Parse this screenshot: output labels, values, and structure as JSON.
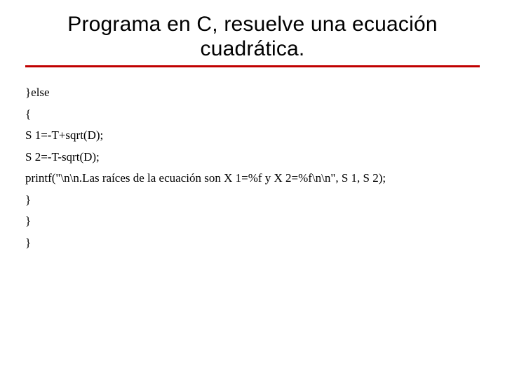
{
  "title": "Programa en C, resuelve una ecuación cuadrática.",
  "lines": {
    "l0": "}else",
    "l1": "{",
    "l2": "S 1=-T+sqrt(D);",
    "l3": "S 2=-T-sqrt(D);",
    "l4": "printf(\"\\n\\n.Las raíces de la ecuación son X 1=%f y X 2=%f\\n\\n\", S 1, S 2);",
    "l5": "}",
    "l6": "}",
    "l7": "}"
  }
}
